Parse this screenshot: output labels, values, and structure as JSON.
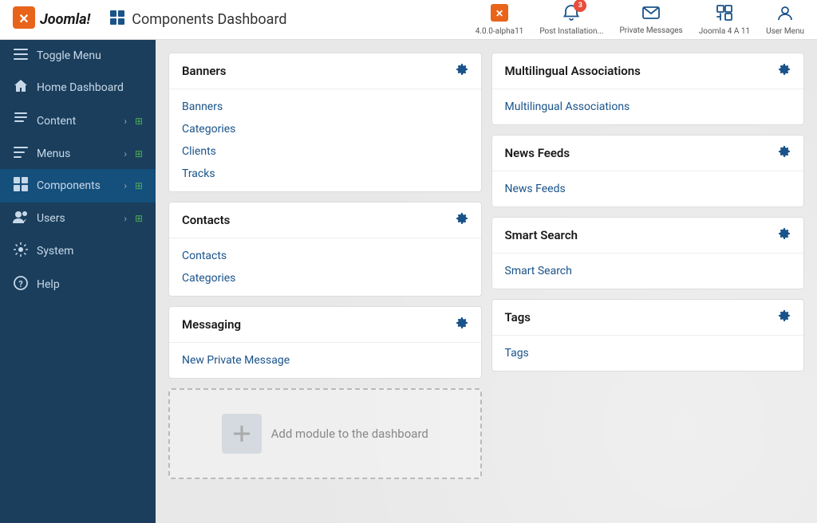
{
  "topbar": {
    "logo_icon": "✕",
    "logo_text": "Joomla!",
    "page_icon": "🔧",
    "page_title": "Components Dashboard",
    "actions": [
      {
        "id": "joomla-version",
        "icon": "✕",
        "label": "4.0.0-alpha11",
        "badge": null
      },
      {
        "id": "post-installation",
        "icon": "🔔",
        "label": "Post Installation...",
        "badge": "3"
      },
      {
        "id": "private-messages",
        "icon": "✉",
        "label": "Private Messages",
        "badge": null
      },
      {
        "id": "joomla-4",
        "icon": "✕",
        "label": "Joomla 4 A 11",
        "badge": null
      },
      {
        "id": "user-menu",
        "icon": "👤",
        "label": "User Menu",
        "badge": null
      }
    ]
  },
  "sidebar": {
    "items": [
      {
        "id": "toggle-menu",
        "icon": "☰",
        "label": "Toggle Menu",
        "arrow": false,
        "grid": false
      },
      {
        "id": "home-dashboard",
        "icon": "🏠",
        "label": "Home Dashboard",
        "arrow": false,
        "grid": false
      },
      {
        "id": "content",
        "icon": "📄",
        "label": "Content",
        "arrow": true,
        "grid": true
      },
      {
        "id": "menus",
        "icon": "☰",
        "label": "Menus",
        "arrow": true,
        "grid": true
      },
      {
        "id": "components",
        "icon": "🔧",
        "label": "Components",
        "arrow": true,
        "grid": true,
        "active": true
      },
      {
        "id": "users",
        "icon": "👥",
        "label": "Users",
        "arrow": true,
        "grid": true
      },
      {
        "id": "system",
        "icon": "⚙",
        "label": "System",
        "arrow": false,
        "grid": false
      },
      {
        "id": "help",
        "icon": "❓",
        "label": "Help",
        "arrow": false,
        "grid": false
      }
    ]
  },
  "dashboard": {
    "left_cards": [
      {
        "id": "banners",
        "title": "Banners",
        "links": [
          "Banners",
          "Categories",
          "Clients",
          "Tracks"
        ]
      },
      {
        "id": "contacts",
        "title": "Contacts",
        "links": [
          "Contacts",
          "Categories"
        ]
      },
      {
        "id": "messaging",
        "title": "Messaging",
        "links": [
          "New Private Message"
        ]
      }
    ],
    "right_cards": [
      {
        "id": "multilingual",
        "title": "Multilingual Associations",
        "links": [
          "Multilingual Associations"
        ]
      },
      {
        "id": "news-feeds",
        "title": "News Feeds",
        "links": [
          "News Feeds"
        ]
      },
      {
        "id": "smart-search",
        "title": "Smart Search",
        "links": [
          "Smart Search"
        ]
      },
      {
        "id": "tags",
        "title": "Tags",
        "links": [
          "Tags"
        ]
      }
    ],
    "add_module_label": "Add module to the dashboard"
  }
}
